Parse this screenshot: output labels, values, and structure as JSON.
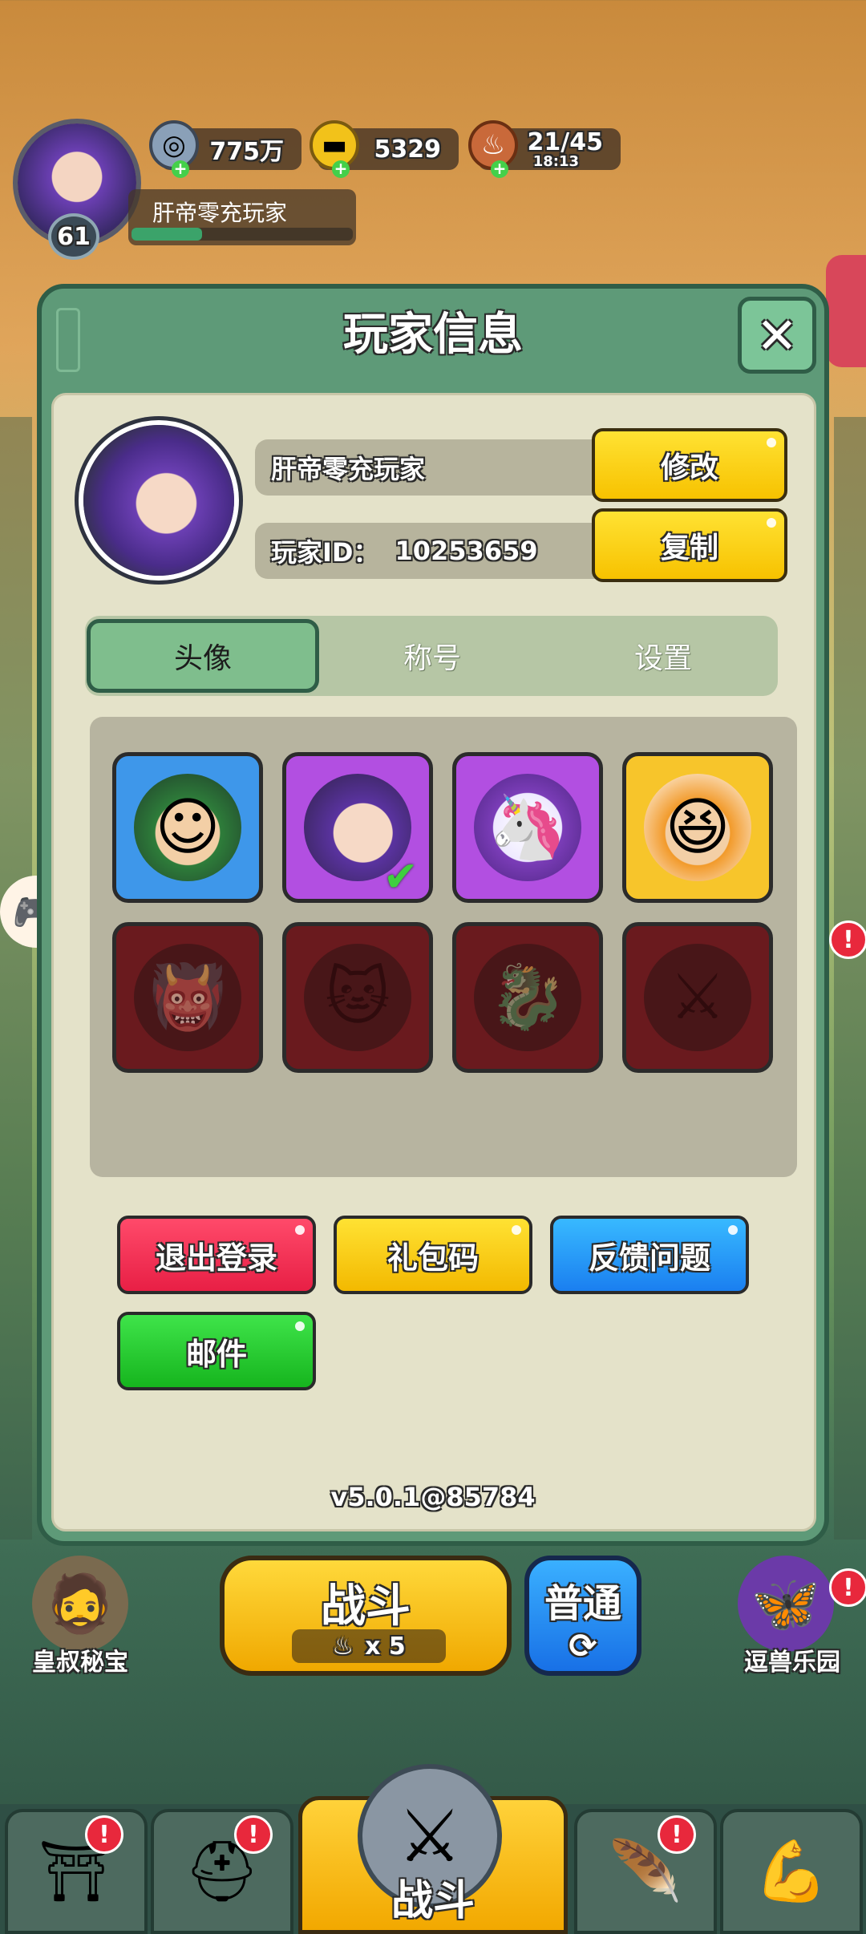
{
  "hud": {
    "player_name": "肝帝零充玩家",
    "level": "61",
    "silver": "775万",
    "gold": "5329",
    "stamina": "21/45",
    "stamina_timer": "18:13",
    "xp_progress": 0.32
  },
  "modal": {
    "title": "玩家信息",
    "close_icon": "close-icon",
    "player_name": "肝帝零充玩家",
    "player_id_label": "玩家ID：",
    "player_id": "10253659",
    "edit_label": "修改",
    "copy_label": "复制",
    "tabs": [
      {
        "label": "头像",
        "active": true
      },
      {
        "label": "称号",
        "active": false
      },
      {
        "label": "设置",
        "active": false
      }
    ],
    "avatars": [
      {
        "icon": "warrior-avatar-icon",
        "frame": "blue",
        "selected": false,
        "locked": false
      },
      {
        "icon": "purple-hair-girl-avatar-icon",
        "frame": "purple",
        "selected": true,
        "locked": false
      },
      {
        "icon": "unicorn-avatar-icon",
        "frame": "purple",
        "selected": false,
        "locked": false
      },
      {
        "icon": "laughing-warrior-avatar-icon",
        "frame": "gold",
        "selected": false,
        "locked": false
      },
      {
        "icon": "red-helmet-warrior-avatar-icon",
        "frame": "red",
        "selected": false,
        "locked": true
      },
      {
        "icon": "lucky-cat-avatar-icon",
        "frame": "red",
        "selected": false,
        "locked": true
      },
      {
        "icon": "dragon-avatar-icon",
        "frame": "red",
        "selected": false,
        "locked": true
      },
      {
        "icon": "armored-general-avatar-icon",
        "frame": "red",
        "selected": false,
        "locked": true
      }
    ],
    "logout_label": "退出登录",
    "gift_code_label": "礼包码",
    "feedback_label": "反馈问题",
    "mail_label": "邮件",
    "version": "v5.0.1@85784"
  },
  "game": {
    "battle_label": "战斗",
    "battle_cost": "x 5",
    "mode_label": "普通",
    "left_feature_label": "皇叔秘宝",
    "right_feature_label": "逗兽乐园",
    "nav_center_label": "战斗",
    "badge_text": "!"
  }
}
